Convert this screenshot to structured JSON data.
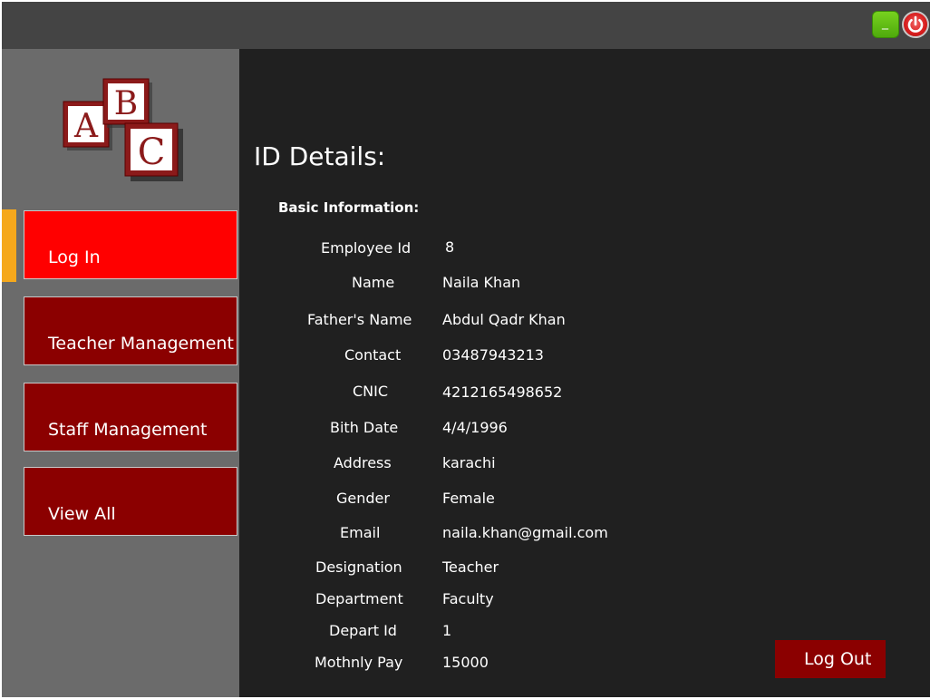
{
  "titlebar": {
    "minimize_label": "_",
    "close_icon": "power-icon",
    "colors": {
      "minimize": "#5cb80f",
      "close": "#d71d1d"
    }
  },
  "logo": {
    "letters": [
      "A",
      "B",
      "C"
    ]
  },
  "sidebar": {
    "items": [
      {
        "label": "Log In",
        "active": true
      },
      {
        "label": "Teacher Management",
        "active": false
      },
      {
        "label": "Staff Management",
        "active": false
      },
      {
        "label": "View All",
        "active": false
      }
    ],
    "colors": {
      "active": "#ff0000",
      "inactive": "#8b0000",
      "indicator": "#f5a81c"
    }
  },
  "main": {
    "title": "ID Details:",
    "section_title": "Basic Information:",
    "fields": [
      {
        "label": "Employee Id",
        "value": "8"
      },
      {
        "label": "Name",
        "value": "Naila Khan"
      },
      {
        "label": "Father's Name",
        "value": "Abdul Qadr Khan"
      },
      {
        "label": "Contact",
        "value": "03487943213"
      },
      {
        "label": "CNIC",
        "value": "4212165498652"
      },
      {
        "label": "Bith Date",
        "value": "4/4/1996"
      },
      {
        "label": "Address",
        "value": "karachi"
      },
      {
        "label": "Gender",
        "value": "Female"
      },
      {
        "label": "Email",
        "value": "naila.khan@gmail.com"
      },
      {
        "label": "Designation",
        "value": "Teacher"
      },
      {
        "label": "Department",
        "value": "Faculty"
      },
      {
        "label": "Depart Id",
        "value": "1"
      },
      {
        "label": "Mothnly Pay",
        "value": "15000"
      }
    ],
    "logout_label": "Log Out"
  }
}
